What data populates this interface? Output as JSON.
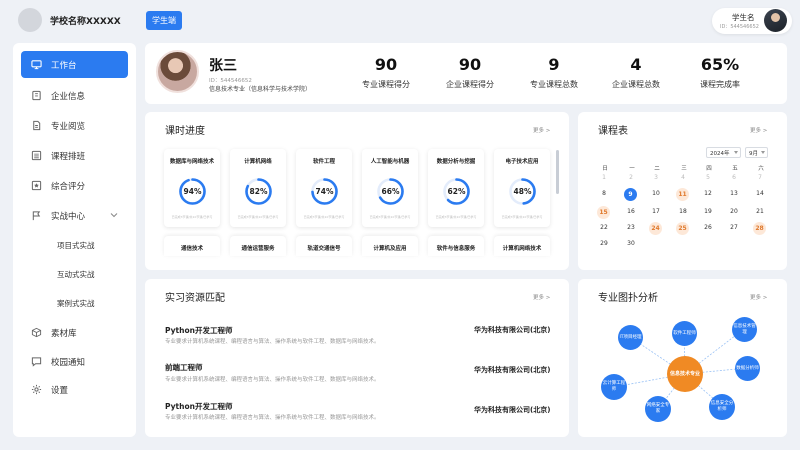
{
  "header": {
    "school_name": "学校名称XXXXX",
    "role_tab": "学生端",
    "user_name": "学生名",
    "user_id": "ID：544546652"
  },
  "sidebar": {
    "items": [
      {
        "label": "工作台",
        "icon": "monitor-icon",
        "active": true
      },
      {
        "label": "企业信息",
        "icon": "building-icon"
      },
      {
        "label": "专业阅览",
        "icon": "document-icon"
      },
      {
        "label": "课程排班",
        "icon": "list-icon"
      },
      {
        "label": "综合评分",
        "icon": "star-icon"
      },
      {
        "label": "实战中心",
        "icon": "flag-icon"
      }
    ],
    "sub_items": [
      "项目式实战",
      "互动式实战",
      "案例式实战"
    ],
    "bottom_items": [
      {
        "label": "素材库",
        "icon": "box-icon"
      },
      {
        "label": "校园通知",
        "icon": "message-icon"
      },
      {
        "label": "设置",
        "icon": "gear-icon"
      }
    ]
  },
  "profile": {
    "name": "张三",
    "id": "ID：544546652",
    "major": "信息技术专业（信息科学与技术学院）",
    "stats": [
      {
        "value": "90",
        "label": "专业课程得分"
      },
      {
        "value": "90",
        "label": "企业课程得分"
      },
      {
        "value": "9",
        "label": "专业课程总数"
      },
      {
        "value": "4",
        "label": "企业课程总数"
      },
      {
        "value": "65%",
        "label": "课程完成率"
      }
    ]
  },
  "progress": {
    "title": "课时进度",
    "more": "更多 >",
    "courses": [
      {
        "name": "数据库与网络技术",
        "percent": 94,
        "label": "94%",
        "meta": "已完成3节课/共10节课/已学习"
      },
      {
        "name": "计算机网络",
        "percent": 82,
        "label": "82%",
        "meta": "已完成3节课/共10节课/已学习"
      },
      {
        "name": "软件工程",
        "percent": 74,
        "label": "74%",
        "meta": "已完成3节课/共10节课/已学习"
      },
      {
        "name": "人工智能与机器",
        "percent": 66,
        "label": "66%",
        "meta": "已完成3节课/共10节课/已学习"
      },
      {
        "name": "数据分析与挖掘",
        "percent": 62,
        "label": "62%",
        "meta": "已完成3节课/共10节课/已学习"
      },
      {
        "name": "电子技术应用",
        "percent": 48,
        "label": "48%",
        "meta": "已完成3节课/共10节课/已学习"
      }
    ],
    "courses_row2": [
      "通信技术",
      "通信运营服务",
      "轨道交通信号",
      "计算机及应用",
      "软件与信息服务",
      "计算机网络技术"
    ]
  },
  "calendar": {
    "title": "课程表",
    "more": "更多 >",
    "year": "2024年",
    "month": "9月",
    "weekdays": [
      "日",
      "一",
      "二",
      "三",
      "四",
      "五",
      "六"
    ],
    "weeks": [
      [
        {
          "d": "1"
        },
        {
          "d": "2"
        },
        {
          "d": "3"
        },
        {
          "d": "4"
        },
        {
          "d": "5"
        },
        {
          "d": "6"
        },
        {
          "d": "7"
        }
      ],
      [
        {
          "d": "8"
        },
        {
          "d": "9"
        },
        {
          "d": "10"
        },
        {
          "d": "11"
        },
        {
          "d": "12"
        },
        {
          "d": "13"
        },
        {
          "d": "14"
        }
      ],
      [
        {
          "d": "15"
        },
        {
          "d": "16"
        },
        {
          "d": "17"
        },
        {
          "d": "18"
        },
        {
          "d": "19"
        },
        {
          "d": "20"
        },
        {
          "d": "21"
        }
      ],
      [
        {
          "d": "22"
        },
        {
          "d": "23"
        },
        {
          "d": "24"
        },
        {
          "d": "25"
        },
        {
          "d": "26"
        },
        {
          "d": "27"
        },
        {
          "d": "28"
        }
      ],
      [
        {
          "d": "29"
        },
        {
          "d": "30"
        },
        {
          "d": ""
        },
        {
          "d": ""
        },
        {
          "d": ""
        },
        {
          "d": ""
        },
        {
          "d": ""
        }
      ]
    ],
    "rows": [
      [
        "",
        "",
        "",
        "",
        "",
        "",
        ""
      ],
      [
        "1",
        "2",
        "3",
        "4",
        "5",
        "6",
        "7"
      ],
      [
        "8",
        "9",
        "10",
        "11",
        "12",
        "13",
        "14"
      ],
      [
        "15",
        "16",
        "17",
        "18",
        "19",
        "20",
        "21"
      ],
      [
        "22",
        "23",
        "24",
        "25",
        "26",
        "27",
        "28"
      ],
      [
        "29",
        "30",
        "",
        "",
        "",
        "",
        ""
      ]
    ]
  },
  "internship": {
    "title": "实习资源匹配",
    "more": "更多 >",
    "jobs": [
      {
        "title": "Python开发工程师",
        "desc": "专业要求计算机系统课程、编程语言与算法、操作系统与软件工程、数据库与网络技术。",
        "company": "华为科技有限公司(北京)"
      },
      {
        "title": "前端工程师",
        "desc": "专业要求计算机系统课程、编程语言与算法、操作系统与软件工程、数据库与网络技术。",
        "company": "华为科技有限公司(北京)"
      },
      {
        "title": "Python开发工程师",
        "desc": "专业要求计算机系统课程、编程语言与算法、操作系统与软件工程、数据库与网络技术。",
        "company": "华为科技有限公司(北京)"
      }
    ]
  },
  "topology": {
    "title": "专业图扑分析",
    "more": "更多 >",
    "center": "信息技术专业",
    "nodes": [
      "IT项目经理",
      "软件工程师",
      "信息技术管理",
      "数据分析师",
      "信息安全分析师",
      "网络安全专家",
      "云计算工程师"
    ]
  }
}
